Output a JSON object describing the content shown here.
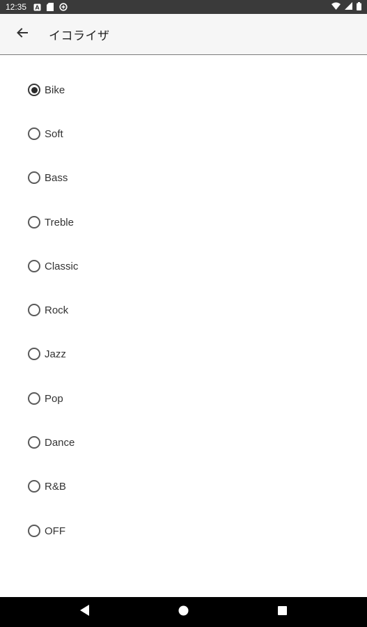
{
  "status_bar": {
    "time": "12:35",
    "left_icons": [
      "notification-a-icon",
      "sd-card-icon",
      "data-saver-icon"
    ],
    "right_icons": [
      "wifi-icon",
      "cell-signal-icon",
      "battery-icon"
    ]
  },
  "app_bar": {
    "back_icon": "arrow-back-icon",
    "title": "イコライザ"
  },
  "equalizer": {
    "selected": "Bike",
    "options": [
      {
        "label": "Bike",
        "checked": true
      },
      {
        "label": "Soft",
        "checked": false
      },
      {
        "label": "Bass",
        "checked": false
      },
      {
        "label": "Treble",
        "checked": false
      },
      {
        "label": "Classic",
        "checked": false
      },
      {
        "label": "Rock",
        "checked": false
      },
      {
        "label": "Jazz",
        "checked": false
      },
      {
        "label": "Pop",
        "checked": false
      },
      {
        "label": "Dance",
        "checked": false
      },
      {
        "label": "R&B",
        "checked": false
      },
      {
        "label": "OFF",
        "checked": false
      }
    ]
  },
  "nav_bar": {
    "buttons": [
      "back-triangle-icon",
      "home-circle-icon",
      "recents-square-icon"
    ]
  },
  "colors": {
    "status_bar_bg": "#3a3a3a",
    "app_bar_bg": "#f6f6f6",
    "nav_bar_bg": "#000000",
    "text": "#212121"
  }
}
